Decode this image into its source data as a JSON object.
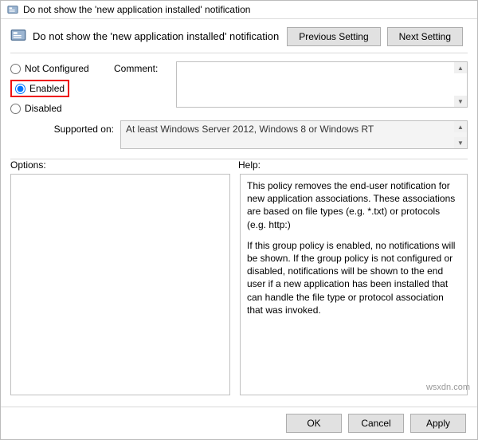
{
  "window": {
    "title": "Do not show the 'new application installed' notification"
  },
  "header": {
    "title": "Do not show the 'new application installed' notification",
    "prev_btn": "Previous Setting",
    "next_btn": "Next Setting"
  },
  "state": {
    "not_configured": "Not Configured",
    "enabled": "Enabled",
    "disabled": "Disabled",
    "selected": "enabled",
    "comment_label": "Comment:",
    "comment_value": ""
  },
  "supported": {
    "label": "Supported on:",
    "value": "At least Windows Server 2012, Windows 8 or Windows RT"
  },
  "sections": {
    "options_label": "Options:",
    "help_label": "Help:"
  },
  "help": {
    "p1": "This policy removes the end-user notification for new application associations. These associations are based on file types (e.g. *.txt) or protocols (e.g. http:)",
    "p2": "If this group policy is enabled, no notifications will be shown. If the group policy is not configured or disabled, notifications will be shown to the end user if a new application has been installed that can handle the file type or protocol association that was invoked."
  },
  "buttons": {
    "ok": "OK",
    "cancel": "Cancel",
    "apply": "Apply"
  },
  "watermark": "wsxdn.com"
}
